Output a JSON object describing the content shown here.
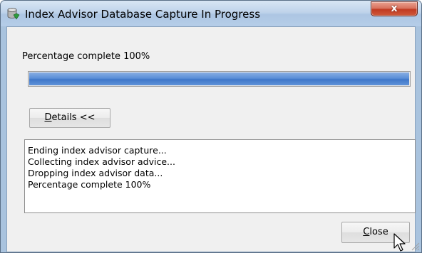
{
  "window": {
    "title": "Index Advisor Database Capture In Progress",
    "icon": "database-app-icon",
    "close_glyph": "x",
    "colors": {
      "frame": "#a9c3de",
      "close": "#c13a21",
      "progress": "#4f84cf"
    }
  },
  "progress": {
    "label": "Percentage complete 100%",
    "fraction": 1.0
  },
  "details_button": {
    "mnemonic": "D",
    "label_rest": "etails <<"
  },
  "log": {
    "lines": [
      "Ending index advisor capture...",
      "Collecting index advisor advice...",
      "Dropping index advisor data...",
      "Percentage complete 100%"
    ]
  },
  "close_button": {
    "mnemonic": "C",
    "label_rest": "lose"
  }
}
